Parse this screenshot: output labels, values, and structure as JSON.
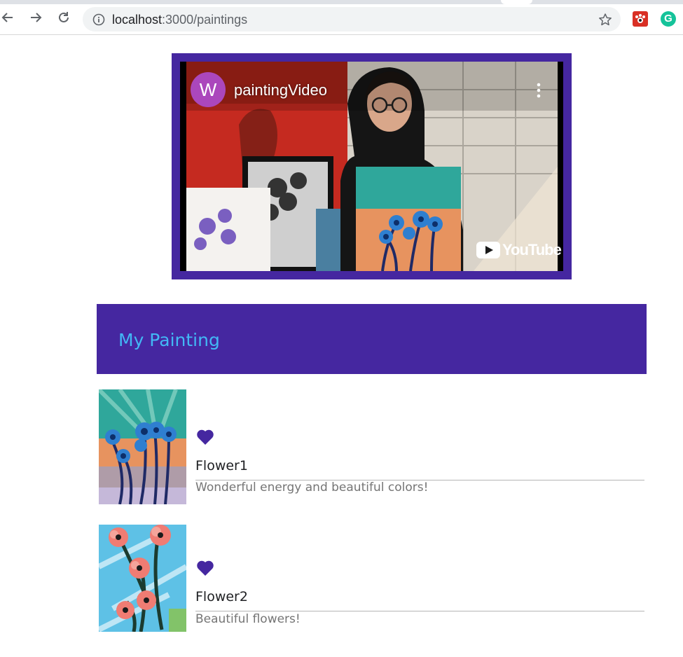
{
  "browser": {
    "url_host": "localhost",
    "url_rest": ":3000/paintings",
    "icons": [
      "back-arrow-icon",
      "forward-arrow-icon",
      "reload-icon",
      "info-icon",
      "star-icon",
      "paw-extension-icon",
      "grammarly-extension-icon"
    ],
    "grammarly_letter": "G"
  },
  "video": {
    "channel_initial": "W",
    "title": "paintingVideo",
    "logo_text": "YouTube",
    "frame_color": "#4527a0"
  },
  "header": {
    "title": "My Painting",
    "background": "#4527a0",
    "title_color": "#42b8f5"
  },
  "paintings": [
    {
      "title": "Flower1",
      "description": "Wonderful energy and beautiful colors!",
      "favorite": true
    },
    {
      "title": "Flower2",
      "description": "Beautiful flowers!",
      "favorite": true
    }
  ],
  "colors": {
    "heart": "#4527a0"
  }
}
